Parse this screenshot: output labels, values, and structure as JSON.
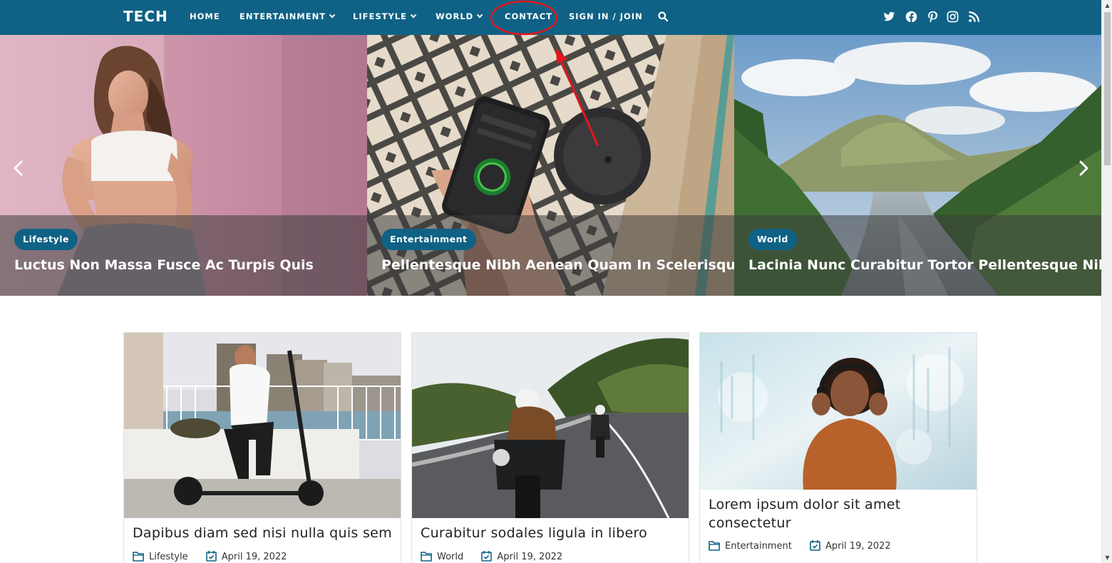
{
  "header": {
    "logo": "TECH",
    "nav": [
      {
        "label": "HOME",
        "has_dropdown": false
      },
      {
        "label": "ENTERTAINMENT",
        "has_dropdown": true
      },
      {
        "label": "LIFESTYLE",
        "has_dropdown": true
      },
      {
        "label": "WORLD",
        "has_dropdown": true
      },
      {
        "label": "CONTACT",
        "has_dropdown": false
      },
      {
        "label": "SIGN IN / JOIN",
        "has_dropdown": false
      }
    ],
    "search_icon": "search-icon",
    "social_icons": [
      "twitter-icon",
      "facebook-icon",
      "pinterest-icon",
      "instagram-icon",
      "rss-icon"
    ],
    "bar_color": "#0f6285"
  },
  "annotation": {
    "target": "CONTACT",
    "color": "#e8141b"
  },
  "slider": {
    "prev_icon": "chevron-left-icon",
    "next_icon": "chevron-right-icon",
    "slides": [
      {
        "category": "Lifestyle",
        "title": "Luctus Non Massa Fusce Ac Turpis Quis"
      },
      {
        "category": "Entertainment",
        "title": "Pellentesque Nibh Aenean Quam In Scelerisque"
      },
      {
        "category": "World",
        "title": "Lacinia Nunc Curabitur Tortor Pellentesque Nibh"
      }
    ]
  },
  "posts": [
    {
      "title": "Dapibus diam sed nisi nulla quis sem",
      "category": "Lifestyle",
      "date": "April 19, 2022"
    },
    {
      "title": "Curabitur sodales ligula in libero",
      "category": "World",
      "date": "April 19, 2022"
    },
    {
      "title": "Lorem ipsum dolor sit amet consectetur",
      "category": "Entertainment",
      "date": "April 19, 2022"
    }
  ]
}
